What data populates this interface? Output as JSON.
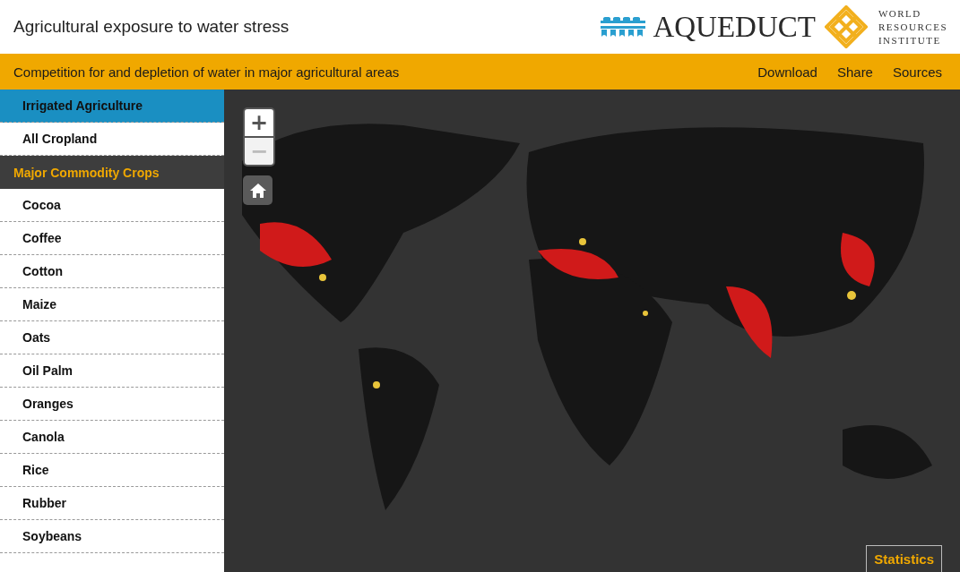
{
  "header": {
    "title": "Agricultural exposure to water stress",
    "logo_text": "AQUEDUCT",
    "partner_lines": [
      "WORLD",
      "RESOURCES",
      "INSTITUTE"
    ]
  },
  "subbar": {
    "subtitle": "Competition for and depletion of water in major agricultural areas",
    "links": [
      "Download",
      "Share",
      "Sources"
    ]
  },
  "sidebar": {
    "items": [
      {
        "kind": "item",
        "label": "Irrigated Agriculture",
        "selected": true
      },
      {
        "kind": "item",
        "label": "All Cropland",
        "selected": false
      },
      {
        "kind": "heading",
        "label": "Major Commodity Crops"
      },
      {
        "kind": "item",
        "label": "Cocoa",
        "selected": false
      },
      {
        "kind": "item",
        "label": "Coffee",
        "selected": false
      },
      {
        "kind": "item",
        "label": "Cotton",
        "selected": false
      },
      {
        "kind": "item",
        "label": "Maize",
        "selected": false
      },
      {
        "kind": "item",
        "label": "Oats",
        "selected": false
      },
      {
        "kind": "item",
        "label": "Oil Palm",
        "selected": false
      },
      {
        "kind": "item",
        "label": "Oranges",
        "selected": false
      },
      {
        "kind": "item",
        "label": "Canola",
        "selected": false
      },
      {
        "kind": "item",
        "label": "Rice",
        "selected": false
      },
      {
        "kind": "item",
        "label": "Rubber",
        "selected": false
      },
      {
        "kind": "item",
        "label": "Soybeans",
        "selected": false
      }
    ]
  },
  "map": {
    "zoom_in": {
      "label": "+",
      "disabled": false
    },
    "zoom_out": {
      "label": "−",
      "disabled": true
    },
    "statistics_button": "Statistics"
  }
}
